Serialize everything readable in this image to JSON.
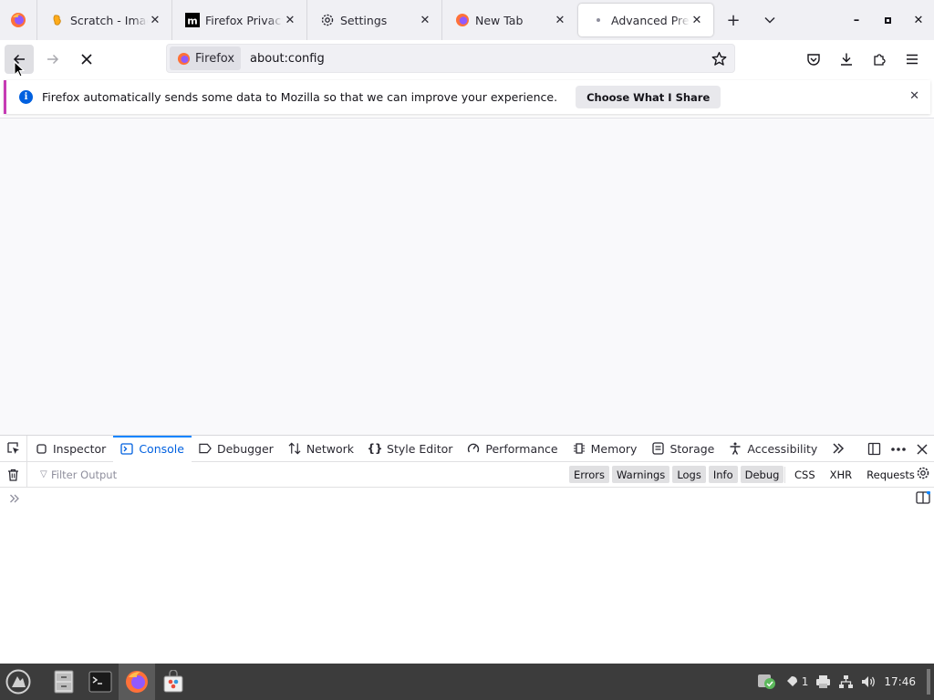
{
  "tabs": [
    {
      "title": "Scratch - Imagine",
      "icon": "scratch-icon",
      "selected": false
    },
    {
      "title": "Firefox Privacy Notice",
      "icon": "mozilla-m-icon",
      "selected": false
    },
    {
      "title": "Settings",
      "icon": "gear-icon",
      "selected": false
    },
    {
      "title": "New Tab",
      "icon": "firefox-icon",
      "selected": false
    },
    {
      "title": "Advanced Preferences",
      "icon": "page-icon",
      "selected": true
    }
  ],
  "navbar": {
    "identity_label": "Firefox",
    "url": "about:config"
  },
  "notification": {
    "message": "Firefox automatically sends some data to Mozilla so that we can improve your experience.",
    "button_label": "Choose What I Share"
  },
  "devtools": {
    "tabs": [
      {
        "label": "Inspector",
        "icon": "inspector-icon"
      },
      {
        "label": "Console",
        "icon": "console-icon",
        "selected": true
      },
      {
        "label": "Debugger",
        "icon": "debugger-icon"
      },
      {
        "label": "Network",
        "icon": "network-icon"
      },
      {
        "label": "Style Editor",
        "icon": "style-editor-icon"
      },
      {
        "label": "Performance",
        "icon": "performance-icon"
      },
      {
        "label": "Memory",
        "icon": "memory-icon"
      },
      {
        "label": "Storage",
        "icon": "storage-icon"
      },
      {
        "label": "Accessibility",
        "icon": "accessibility-icon"
      }
    ],
    "filter_placeholder": "Filter Output",
    "levels": [
      {
        "label": "Errors",
        "on": true
      },
      {
        "label": "Warnings",
        "on": true
      },
      {
        "label": "Logs",
        "on": true
      },
      {
        "label": "Info",
        "on": true
      },
      {
        "label": "Debug",
        "on": true
      }
    ],
    "net_filters": [
      "CSS",
      "XHR",
      "Requests"
    ]
  },
  "taskbar": {
    "notification_count": "1",
    "clock": "17:46"
  },
  "colors": {
    "accent": "#0060df",
    "notification_bar": "#c63bb4",
    "taskbar": "#3c3c3c"
  }
}
